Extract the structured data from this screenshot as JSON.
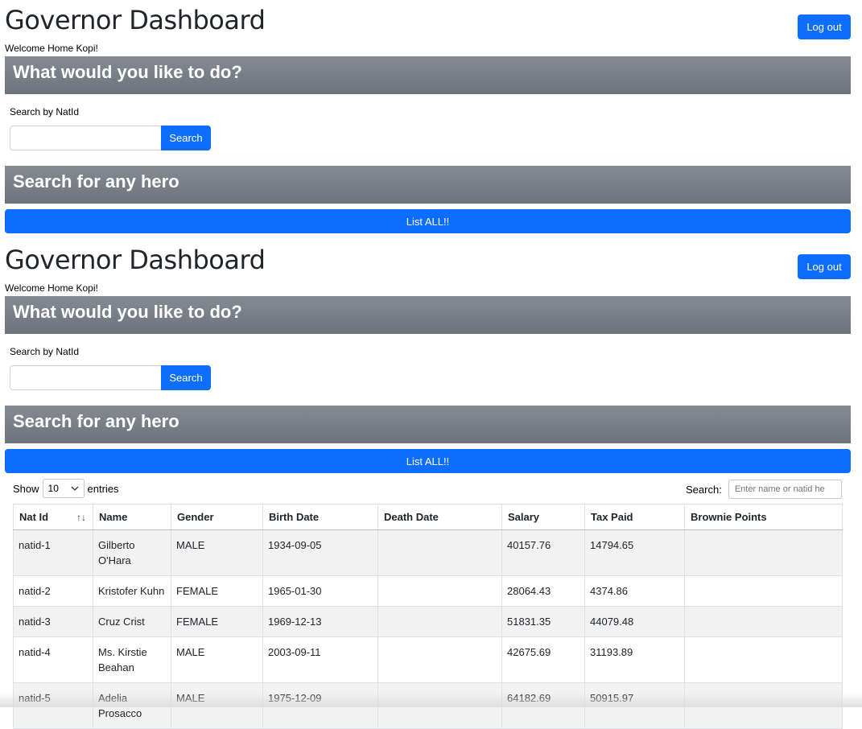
{
  "dashboard": {
    "title": "Governor Dashboard",
    "logout_label": "Log out",
    "welcome": "Welcome Home Kopi!",
    "banner_todo": "What would you like to do?",
    "search_label": "Search by NatId",
    "search_button": "Search",
    "banner_hero": "Search for any hero",
    "list_all_button": "List ALL!!"
  },
  "datatable": {
    "show_label": "Show",
    "page_size": "10",
    "entries_label": "entries",
    "search_label": "Search:",
    "search_placeholder": "Enter name or natid he",
    "columns": [
      "Nat Id",
      "Name",
      "Gender",
      "Birth Date",
      "Death Date",
      "Salary",
      "Tax Paid",
      "Brownie Points"
    ],
    "rows": [
      [
        "natid-1",
        "Gilberto O'Hara",
        "MALE",
        "1934-09-05",
        "",
        "40157.76",
        "14794.65",
        ""
      ],
      [
        "natid-2",
        "Kristofer Kuhn",
        "FEMALE",
        "1965-01-30",
        "",
        "28064.43",
        "4374.86",
        ""
      ],
      [
        "natid-3",
        "Cruz Crist",
        "FEMALE",
        "1969-12-13",
        "",
        "51831.35",
        "44079.48",
        ""
      ],
      [
        "natid-4",
        "Ms. Kirstie Beahan",
        "MALE",
        "2003-09-11",
        "",
        "42675.69",
        "31193.89",
        ""
      ],
      [
        "natid-5",
        "Adelia Prosacco",
        "MALE",
        "1975-12-09",
        "",
        "64182.69",
        "50915.97",
        ""
      ]
    ]
  },
  "colors": {
    "primary": "#0d6efd",
    "banner": "#6c757d"
  }
}
